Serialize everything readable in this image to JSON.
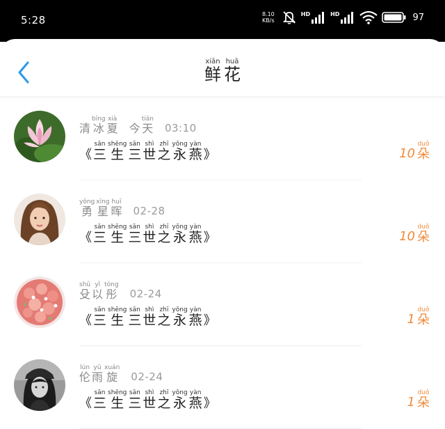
{
  "status_bar": {
    "time": "5:28",
    "net_speed_value": "8.10",
    "net_speed_unit": "KB/s",
    "hd1": "HD",
    "hd2": "HD",
    "battery": "97"
  },
  "header": {
    "title": [
      {
        "hz": "鲜",
        "py": "xiān"
      },
      {
        "hz": "花",
        "py": "huā"
      }
    ]
  },
  "gift_open": "《",
  "gift_close": "》",
  "gift_chars": [
    {
      "hz": "三",
      "py": "sān"
    },
    {
      "hz": "生",
      "py": "shēng"
    },
    {
      "hz": "三",
      "py": "sān"
    },
    {
      "hz": "世",
      "py": "shì"
    },
    {
      "hz": "之",
      "py": "zhī"
    },
    {
      "hz": "永",
      "py": "yǒng"
    },
    {
      "hz": "燕",
      "py": "yàn"
    }
  ],
  "unit": {
    "hz": "朵",
    "py": "duǒ"
  },
  "records": [
    {
      "name": [
        {
          "hz": "清",
          "py": ""
        },
        {
          "hz": "冰",
          "py": "bīng"
        },
        {
          "hz": "夏",
          "py": "xià"
        }
      ],
      "day": [
        {
          "hz": "今",
          "py": ""
        },
        {
          "hz": "天",
          "py": "tiān"
        }
      ],
      "time": "03:10",
      "count": "10",
      "avatar": "lotus"
    },
    {
      "name": [
        {
          "hz": "勇",
          "py": "yǒng"
        },
        {
          "hz": "星",
          "py": "xīng"
        },
        {
          "hz": "晖",
          "py": "huī"
        }
      ],
      "day": [],
      "time": "02-28",
      "count": "10",
      "avatar": "woman"
    },
    {
      "name": [
        {
          "hz": "殳",
          "py": "shū"
        },
        {
          "hz": "以",
          "py": "yǐ"
        },
        {
          "hz": "彤",
          "py": "tóng"
        }
      ],
      "day": [],
      "time": "02-24",
      "count": "1",
      "avatar": "roses"
    },
    {
      "name": [
        {
          "hz": "伦",
          "py": "lún"
        },
        {
          "hz": "雨",
          "py": "yǔ"
        },
        {
          "hz": "旋",
          "py": "xuán"
        }
      ],
      "day": [],
      "time": "02-24",
      "count": "1",
      "avatar": "girl-bw"
    }
  ],
  "colors": {
    "accent": "#2f9be8",
    "count": "#f08a3a",
    "status_bg": "#000000"
  }
}
